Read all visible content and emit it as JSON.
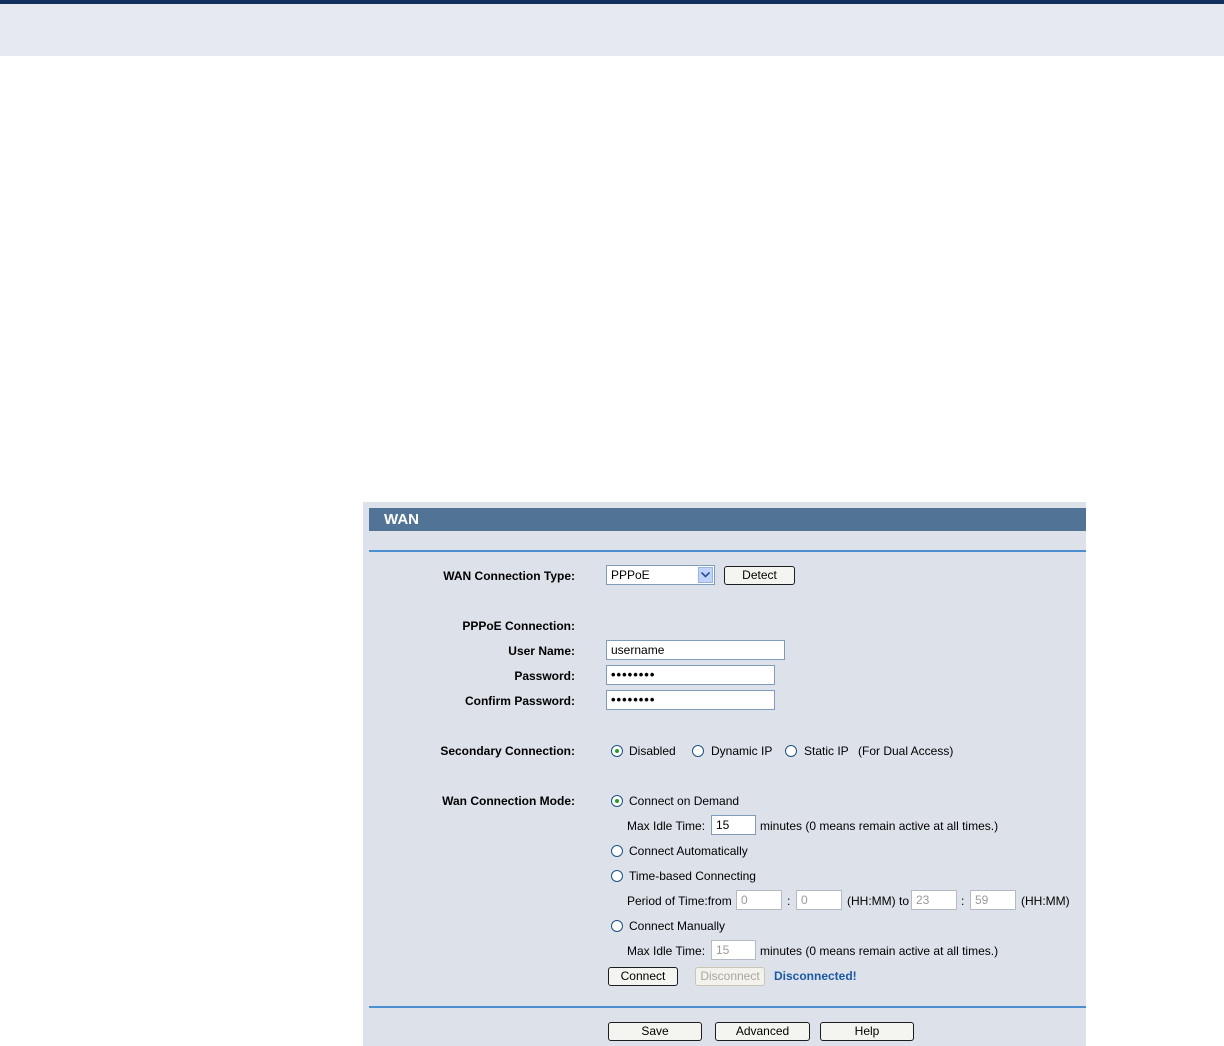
{
  "panel": {
    "title": "WAN"
  },
  "connection_type": {
    "label": "WAN Connection Type:",
    "value": "PPPoE",
    "detect_label": "Detect"
  },
  "pppoe": {
    "section_label": "PPPoE Connection:",
    "username_label": "User Name:",
    "username_value": "username",
    "password_label": "Password:",
    "password_value": "••••••••",
    "confirm_label": "Confirm Password:",
    "confirm_value": "••••••••"
  },
  "secondary": {
    "label": "Secondary Connection:",
    "options": [
      "Disabled",
      "Dynamic IP",
      "Static IP"
    ],
    "selected": "Disabled",
    "note": "(For Dual Access)"
  },
  "mode": {
    "label": "Wan Connection Mode:",
    "selected": "Connect on Demand",
    "on_demand": {
      "label": "Connect on Demand",
      "idle_label": "Max Idle Time:",
      "idle_value": "15",
      "idle_note": "minutes (0 means remain active at all times.)"
    },
    "automatic": {
      "label": "Connect Automatically"
    },
    "time_based": {
      "label": "Time-based Connecting",
      "period_label": "Period of Time:from",
      "from_h": "0",
      "from_m": "0",
      "sep": ":",
      "hhmm_to": "(HH:MM) to",
      "to_h": "23",
      "to_m": "59",
      "hhmm": "(HH:MM)"
    },
    "manual": {
      "label": "Connect Manually",
      "idle_label": "Max Idle Time:",
      "idle_value": "15",
      "idle_note": "minutes (0 means remain active at all times.)"
    }
  },
  "actions": {
    "connect": "Connect",
    "disconnect": "Disconnect",
    "status": "Disconnected!"
  },
  "footer": {
    "save": "Save",
    "advanced": "Advanced",
    "help": "Help"
  },
  "colors": {
    "title_bar": "#517396",
    "panel_bg": "#dde1ea",
    "divider": "#4a8fcf",
    "status": "#1b5aa3",
    "top_band": "#e6e9f0"
  }
}
